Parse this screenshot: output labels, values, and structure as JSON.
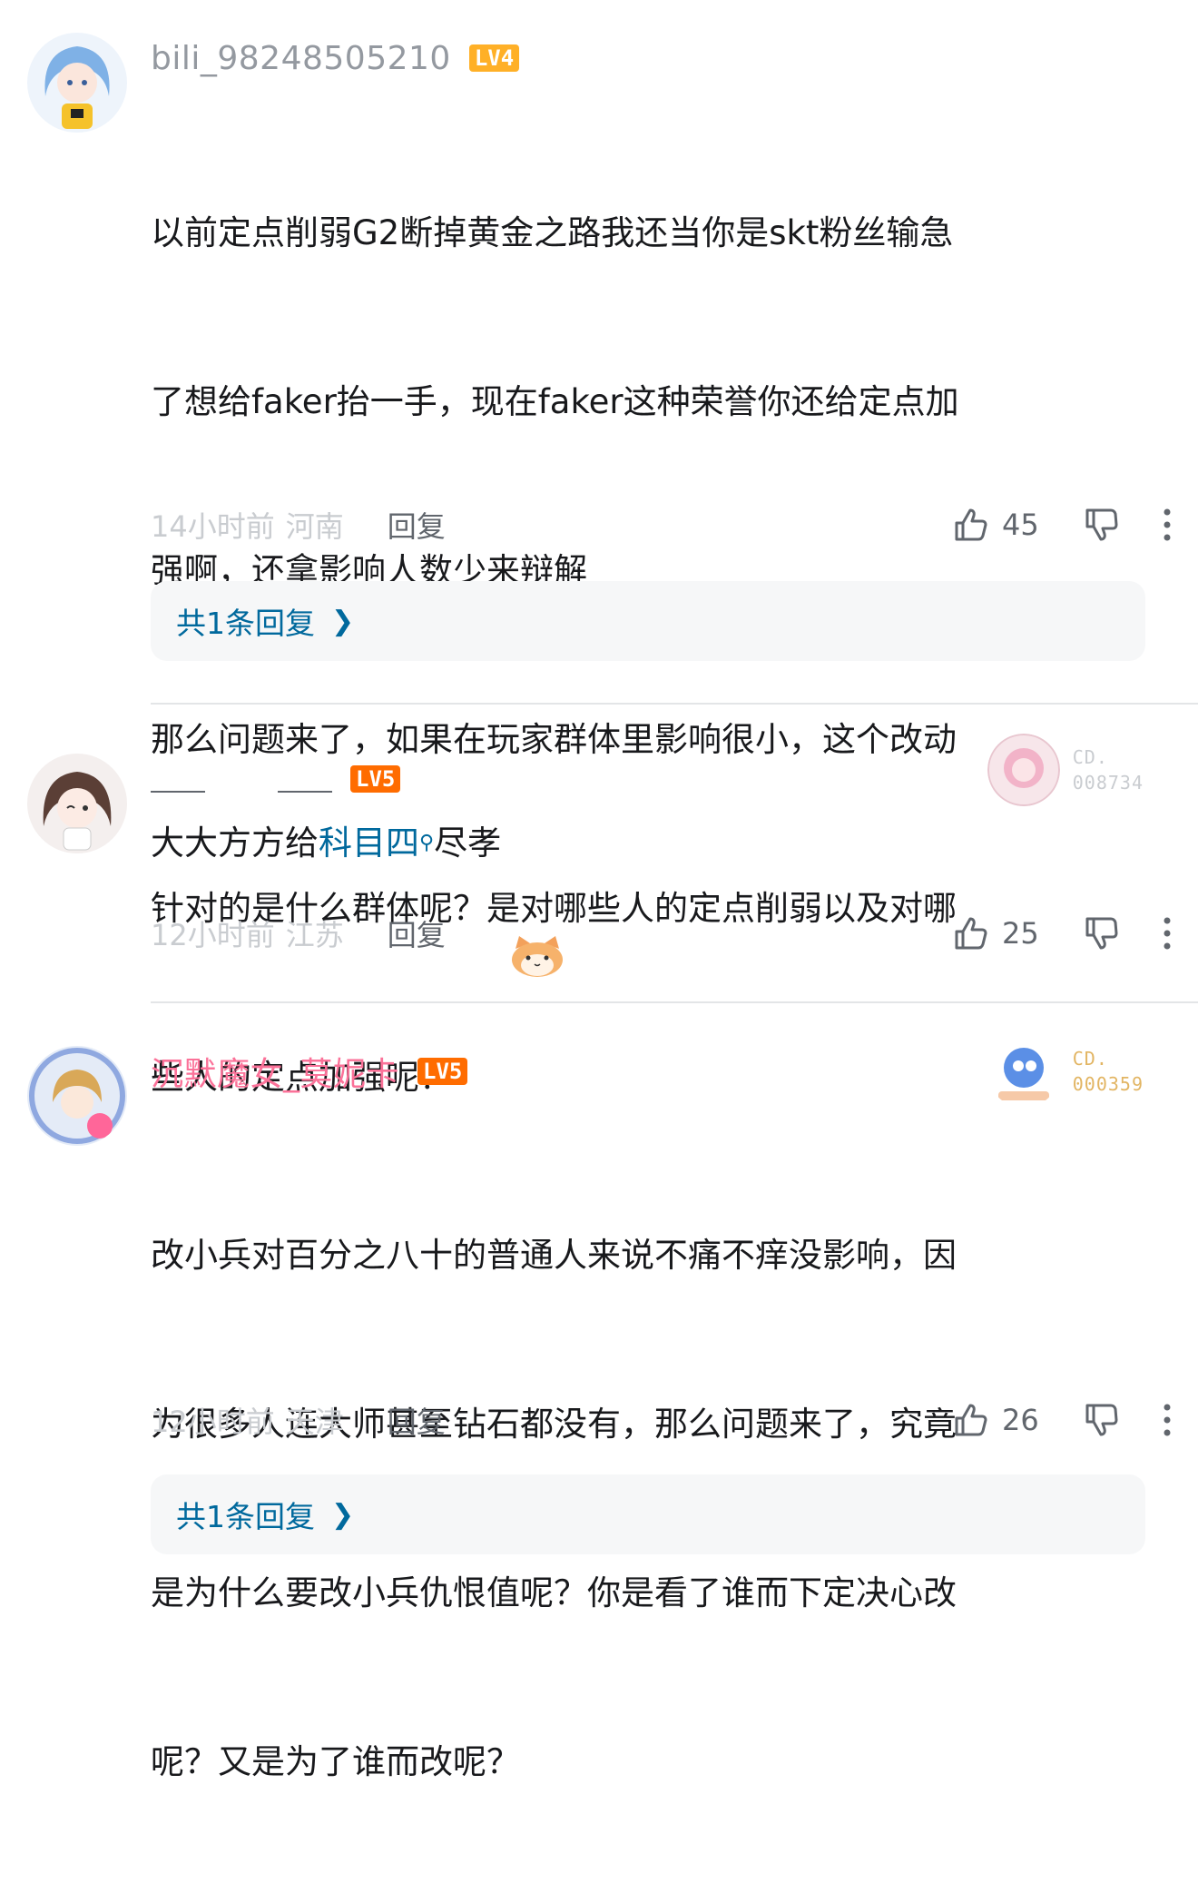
{
  "comments": [
    {
      "username": "bili_98248505210",
      "level": "LV4",
      "text_lines": [
        "以前定点削弱G2断掉黄金之路我还当你是skt粉丝输急",
        "了想给faker抬一手，现在faker这种荣誉你还给定点加",
        "强啊，还拿影响人数少来辩解",
        "那么问题来了，如果在玩家群体里影响很小，这个改动",
        "针对的是什么群体呢？是对哪些人的定点削弱以及对哪",
        "些人的定点加强呢？"
      ],
      "time": "14小时前",
      "location": "河南",
      "reply_label": "回复",
      "likes": "45",
      "reply_summary": "共1条回复"
    },
    {
      "username": "",
      "level": "LV5",
      "text_prefix": "大大方方给",
      "text_link": "科目四",
      "text_suffix": "尽孝",
      "emoji": "cat-face-emoji",
      "badge_prefix": "CD.",
      "badge_number": "008734",
      "time": "12小时前",
      "location": "江苏",
      "reply_label": "回复",
      "likes": "25"
    },
    {
      "username": "沉默魔女_莫妮卡",
      "level": "LV5",
      "text_lines": [
        "改小兵对百分之八十的普通人来说不痛不痒没影响，因",
        "为很多人连大师甚至钻石都没有，那么问题来了，究竟",
        "是为什么要改小兵仇恨值呢？你是看了谁而下定决心改",
        "呢？又是为了谁而改呢？"
      ],
      "badge_prefix": "CD.",
      "badge_number": "000359",
      "time": "12小时前",
      "location": "天津",
      "reply_label": "回复",
      "likes": "26",
      "reply_summary": "共1条回复"
    }
  ],
  "colors": {
    "link": "#00699d",
    "lv4": "#ffb027",
    "lv5": "#ff6c00",
    "vip_name": "#fb7299",
    "meta": "#c9ccd0"
  }
}
